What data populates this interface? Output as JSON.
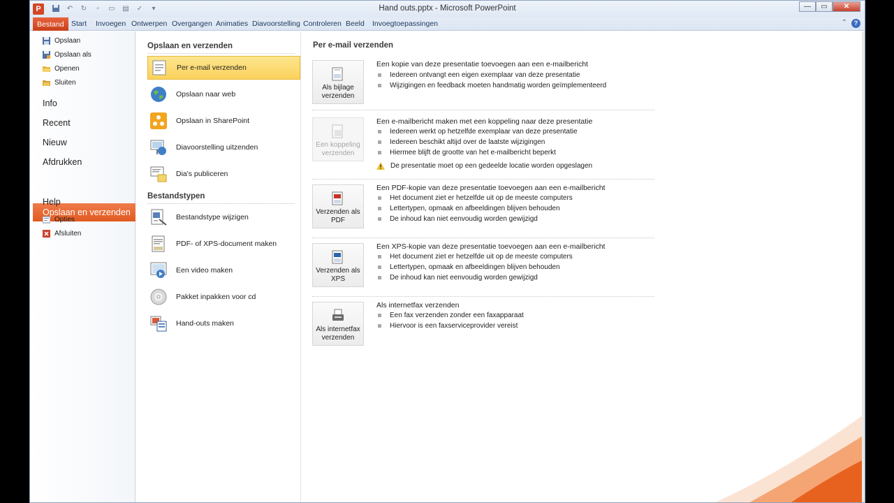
{
  "window": {
    "title": "Hand outs.pptx - Microsoft PowerPoint",
    "app_letter": "P",
    "minimize_label": "—",
    "maximize_label": "▭",
    "close_label": "✕"
  },
  "ribbon": {
    "tabs": [
      "Bestand",
      "Start",
      "Invoegen",
      "Ontwerpen",
      "Overgangen",
      "Animaties",
      "Diavoorstelling",
      "Controleren",
      "Beeld",
      "Invoegtoepassingen"
    ],
    "collapse_glyph": "⌃",
    "help_glyph": "?"
  },
  "leftnav": {
    "small_top": [
      "Opslaan",
      "Opslaan als",
      "Openen",
      "Sluiten"
    ],
    "big": [
      "Info",
      "Recent",
      "Nieuw",
      "Afdrukken",
      "Opslaan en verzenden",
      "Help"
    ],
    "small_bottom": [
      "Opties",
      "Afsluiten"
    ]
  },
  "middle": {
    "section1_title": "Opslaan en verzenden",
    "section1_items": [
      "Per e-mail verzenden",
      "Opslaan naar web",
      "Opslaan in SharePoint",
      "Diavoorstelling uitzenden",
      "Dia's publiceren"
    ],
    "section2_title": "Bestandstypen",
    "section2_items": [
      "Bestandstype wijzigen",
      "PDF- of XPS-document maken",
      "Een video maken",
      "Pakket inpakken voor cd",
      "Hand-outs maken"
    ]
  },
  "content": {
    "title": "Per e-mail verzenden",
    "options": [
      {
        "button": [
          "Als bijlage",
          "verzenden"
        ],
        "description": "Een kopie van deze presentatie toevoegen aan een e-mailbericht",
        "bullets": [
          "Iedereen ontvangt een eigen exemplaar van deze presentatie",
          "Wijzigingen en feedback moeten handmatig worden geïmplementeerd"
        ]
      },
      {
        "button": [
          "Een koppeling",
          "verzenden"
        ],
        "description": "Een e-mailbericht maken met een koppeling naar deze presentatie",
        "bullets": [
          "Iedereen werkt op hetzelfde exemplaar van deze presentatie",
          "Iedereen beschikt altijd over de laatste wijzigingen",
          "Hiermee blijft de grootte van het e-mailbericht beperkt"
        ],
        "warning": "De presentatie moet op een gedeelde locatie worden opgeslagen"
      },
      {
        "button": [
          "Verzenden als",
          "PDF"
        ],
        "description": "Een PDF-kopie van deze presentatie toevoegen aan een e-mailbericht",
        "bullets": [
          "Het document ziet er hetzelfde uit op de meeste computers",
          "Lettertypen, opmaak en afbeeldingen blijven behouden",
          "De inhoud kan niet eenvoudig worden gewijzigd"
        ]
      },
      {
        "button": [
          "Verzenden als",
          "XPS"
        ],
        "description": "Een XPS-kopie van deze presentatie toevoegen aan een e-mailbericht",
        "bullets": [
          "Het document ziet er hetzelfde uit op de meeste computers",
          "Lettertypen, opmaak en afbeeldingen blijven behouden",
          "De inhoud kan niet eenvoudig worden gewijzigd"
        ]
      },
      {
        "button": [
          "Als internetfax",
          "verzenden"
        ],
        "description": "Als internetfax verzenden",
        "bullets": [
          "Een fax verzenden zonder een faxapparaat",
          "Hiervoor is een faxserviceprovider vereist"
        ]
      }
    ]
  },
  "colors": {
    "accent_orange": "#e15a20",
    "selection_yellow": "#fbd25c",
    "ribbon_blue": "#dce6f3"
  }
}
